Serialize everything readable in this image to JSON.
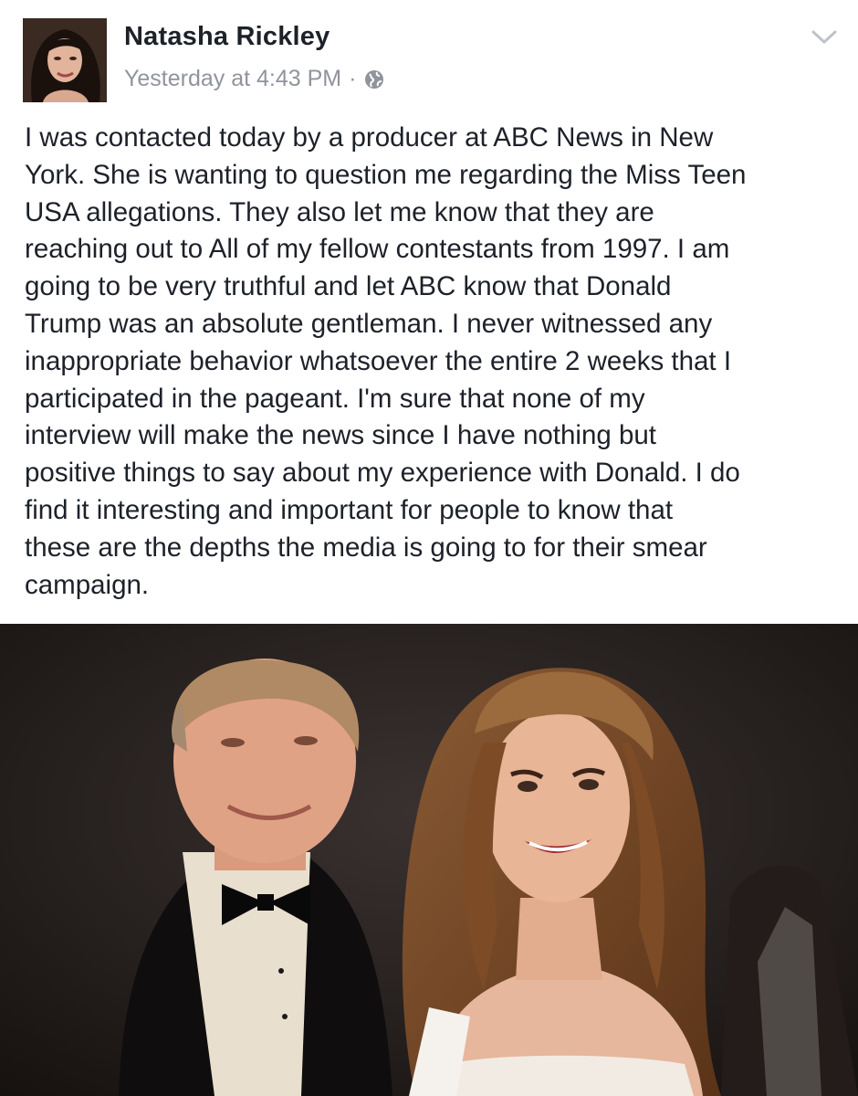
{
  "post": {
    "author_name": "Natasha Rickley",
    "timestamp": "Yesterday at 4:43 PM",
    "separator": "·",
    "privacy_icon": "globe-icon",
    "menu_icon": "chevron-down-icon",
    "text": "I was contacted today by a producer at ABC News in New\nYork. She is wanting to question me regarding the Miss Teen\nUSA allegations. They also let me know that they are\nreaching out to All of my fellow contestants from 1997. I am\ngoing to be very truthful and let ABC know that Donald\nTrump was an absolute gentleman. I never witnessed any\ninappropriate behavior whatsoever the entire 2 weeks that I\nparticipated in the pageant. I'm sure that none of my\ninterview will make the news since I have nothing but\npositive things to say about my experience with Donald. I do\nfind it interesting and important for people to know that\nthese are the depths the media is going to for their smear\ncampaign."
  },
  "colors": {
    "name": "#1d2129",
    "meta": "#90949c",
    "body_text": "#1d2129",
    "background": "#ffffff"
  }
}
